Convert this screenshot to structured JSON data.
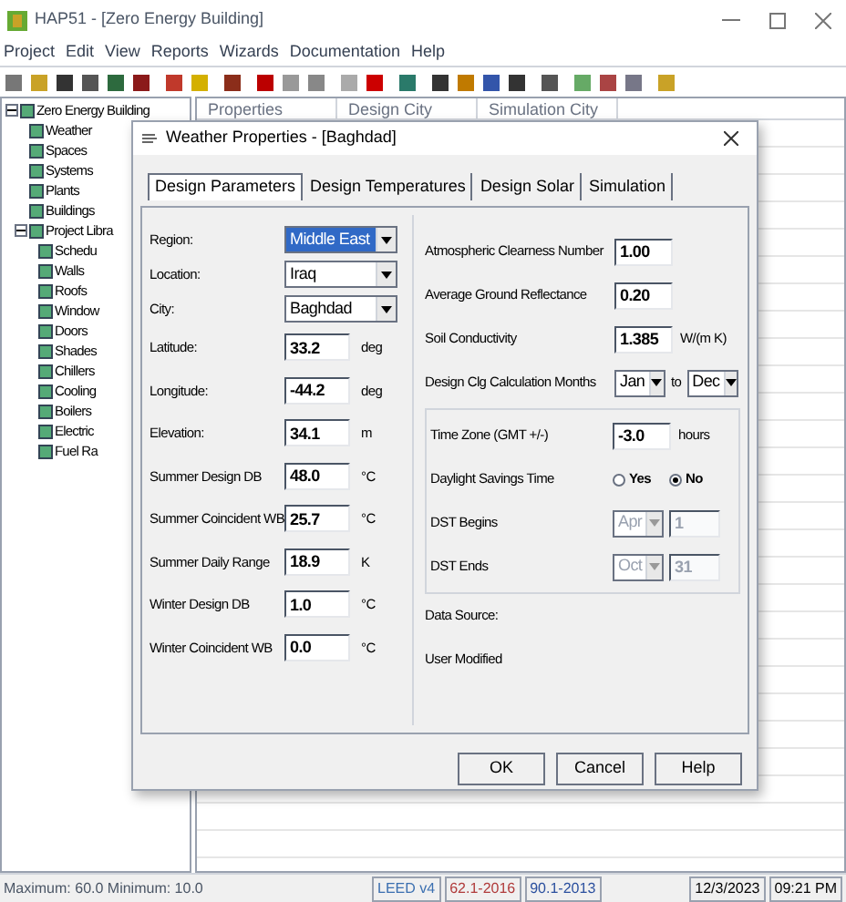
{
  "window": {
    "title": "HAP51 - [Zero Energy Building]"
  },
  "menu": [
    "Project",
    "Edit",
    "View",
    "Reports",
    "Wizards",
    "Documentation",
    "Help"
  ],
  "tree": {
    "items": [
      {
        "label": "Zero Energy Building",
        "expanded": true,
        "children": [
          {
            "label": "Weather"
          },
          {
            "label": "Spaces"
          },
          {
            "label": "Systems"
          },
          {
            "label": "Plants"
          },
          {
            "label": "Buildings"
          },
          {
            "label": "Project Libra",
            "expanded": true,
            "children": [
              {
                "label": "Schedu"
              },
              {
                "label": "Walls"
              },
              {
                "label": "Roofs"
              },
              {
                "label": "Window"
              },
              {
                "label": "Doors"
              },
              {
                "label": "Shades"
              },
              {
                "label": "Chillers"
              },
              {
                "label": "Cooling"
              },
              {
                "label": "Boilers"
              },
              {
                "label": "Electric"
              },
              {
                "label": "Fuel Ra"
              }
            ]
          }
        ]
      }
    ]
  },
  "table": {
    "columns": [
      "Properties",
      "Design City",
      "Simulation City"
    ]
  },
  "dialog": {
    "title": "Weather Properties - [Baghdad]",
    "tabs": [
      {
        "label": "Design Parameters",
        "selected": true
      },
      {
        "label": "Design Temperatures",
        "selected": false
      },
      {
        "label": "Design Solar",
        "selected": false
      },
      {
        "label": "Simulation",
        "selected": false
      }
    ],
    "left_fields": [
      {
        "kind": "dropdown",
        "label": "Region:",
        "value": "Middle East",
        "focused": true
      },
      {
        "kind": "dropdown",
        "label": "Location:",
        "value": "Iraq",
        "focused": false
      },
      {
        "kind": "dropdown",
        "label": "City:",
        "value": "Baghdad",
        "focused": false
      },
      {
        "kind": "number",
        "label": "Latitude:",
        "value": "33.2",
        "unit": "deg"
      },
      {
        "kind": "number",
        "label": "Longitude:",
        "value": "-44.2",
        "unit": "deg"
      },
      {
        "kind": "number",
        "label": "Elevation:",
        "value": "34.1",
        "unit": "m"
      },
      {
        "kind": "number",
        "label": "Summer Design DB",
        "value": "48.0",
        "unit": "°C"
      },
      {
        "kind": "number",
        "label": "Summer Coincident WB",
        "value": "25.7",
        "unit": "°C"
      },
      {
        "kind": "number",
        "label": "Summer Daily Range",
        "value": "18.9",
        "unit": "K"
      },
      {
        "kind": "number",
        "label": "Winter Design DB",
        "value": "1.0",
        "unit": "°C"
      },
      {
        "kind": "number",
        "label": "Winter Coincident WB",
        "value": "0.0",
        "unit": "°C"
      }
    ],
    "right_fields": [
      {
        "kind": "number",
        "label": "Atmospheric Clearness Number",
        "value": "1.00"
      },
      {
        "kind": "number",
        "label": "Average Ground Reflectance",
        "value": "0.20"
      },
      {
        "kind": "number",
        "label": "Soil Conductivity",
        "value": "1.385",
        "unit": "W/(m K)"
      },
      {
        "kind": "range",
        "label": "Design Clg Calculation Months",
        "from": "Jan",
        "separator": "to",
        "to": "Dec"
      }
    ],
    "time_group": [
      {
        "kind": "number",
        "label": "Time Zone (GMT +/-)",
        "value": "-3.0",
        "unit": "hours"
      },
      {
        "kind": "radio",
        "label": "Daylight Savings Time",
        "options": [
          {
            "label": "Yes",
            "selected": false
          },
          {
            "label": "No",
            "selected": true
          }
        ]
      },
      {
        "kind": "date",
        "label": "DST Begins",
        "month": "Apr",
        "day": "1",
        "disabled": true
      },
      {
        "kind": "date",
        "label": "DST Ends",
        "month": "Oct",
        "day": "31",
        "disabled": true
      }
    ],
    "info": [
      "Data Source:",
      "User Modified"
    ],
    "buttons": [
      "OK",
      "Cancel",
      "Help"
    ]
  },
  "status_bar": {
    "message": "Maximum: 60.0 Minimum: 10.0",
    "badges": [
      {
        "label": "LEED v4",
        "color": "#3b6fb0"
      },
      {
        "label": "62.1-2016",
        "color": "#b03b3b"
      },
      {
        "label": "90.1-2013",
        "color": "#2a4f9e"
      }
    ],
    "date": "12/3/2023",
    "time": "09:21 PM"
  }
}
